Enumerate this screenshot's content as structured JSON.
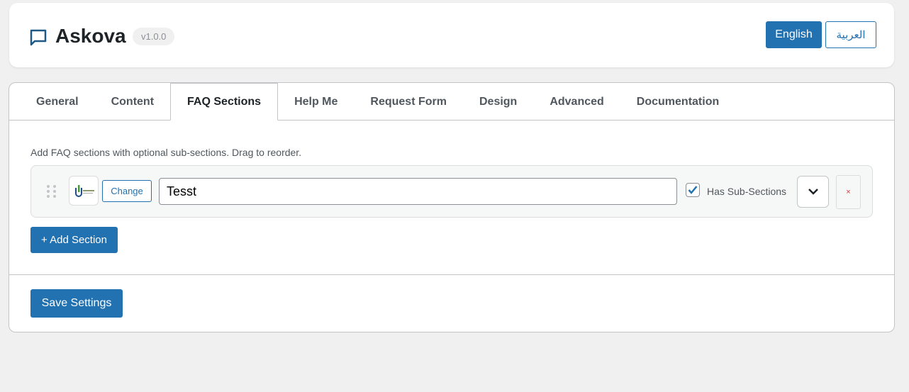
{
  "header": {
    "title": "Askova",
    "version": "v1.0.0",
    "lang_en": "English",
    "lang_ar": "العربية"
  },
  "tabs": [
    "General",
    "Content",
    "FAQ Sections",
    "Help Me",
    "Request Form",
    "Design",
    "Advanced",
    "Documentation"
  ],
  "active_tab": "FAQ Sections",
  "faq": {
    "description": "Add FAQ sections with optional sub-sections. Drag to reorder.",
    "sections": [
      {
        "name": "Tesst",
        "change_label": "Change",
        "has_sub_sections": true,
        "has_sub_label": "Has Sub-Sections",
        "delete_label": "×"
      }
    ],
    "add_label": "+ Add Section"
  },
  "save_label": "Save Settings"
}
